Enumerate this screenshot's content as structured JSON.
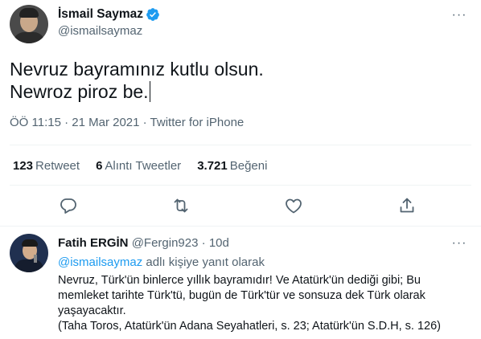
{
  "tweet": {
    "display_name": "İsmail Saymaz",
    "handle": "@ismailsaymaz",
    "text_lines": [
      "Nevruz bayramınız kutlu olsun.",
      "Newroz piroz be."
    ],
    "meta": "ÖÖ 11:15 · 21 Mar 2021 · Twitter for iPhone",
    "stats": [
      {
        "count": "123",
        "label": "Retweet"
      },
      {
        "count": "6",
        "label": "Alıntı Tweetler"
      },
      {
        "count": "3.721",
        "label": "Beğeni"
      }
    ],
    "actions": [
      "reply-icon",
      "retweet-icon",
      "like-icon",
      "share-icon"
    ]
  },
  "reply": {
    "display_name": "Fatih ERGİN",
    "handle": "@Fergin923",
    "separator": "·",
    "time": "10d",
    "mention": "@ismailsaymaz",
    "reply_to_suffix": " adlı kişiye yanıt olarak",
    "body_lines": [
      "Nevruz, Türk'ün binlerce yıllık bayramıdır! Ve Atatürk'ün dediği gibi; Bu",
      "memleket tarihte Türk'tü, bugün de Türk'tür ve sonsuza dek Türk olarak",
      "yaşayacaktır.",
      "(Taha Toros, Atatürk'ün Adana Seyahatleri, s. 23; Atatürk'ün S.D.H, s. 126)"
    ]
  },
  "colors": {
    "accent": "#1d9bf0",
    "secondary_text": "#536471",
    "divider": "#eff3f4"
  }
}
